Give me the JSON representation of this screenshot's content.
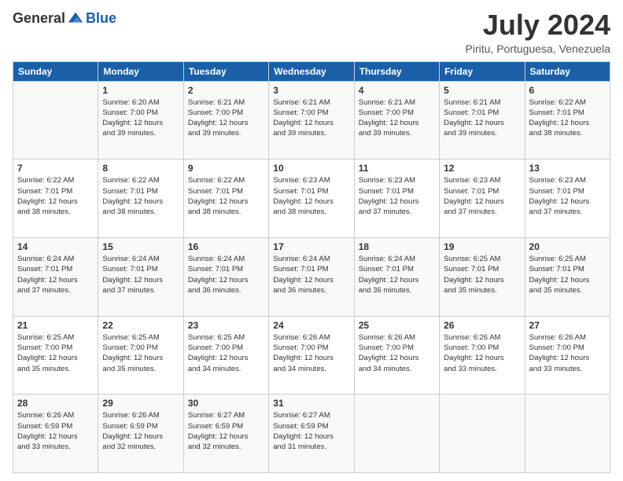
{
  "header": {
    "logo_general": "General",
    "logo_blue": "Blue",
    "month_title": "July 2024",
    "location": "Piritu, Portuguesa, Venezuela"
  },
  "days_of_week": [
    "Sunday",
    "Monday",
    "Tuesday",
    "Wednesday",
    "Thursday",
    "Friday",
    "Saturday"
  ],
  "weeks": [
    [
      {
        "day": "",
        "info": ""
      },
      {
        "day": "1",
        "info": "Sunrise: 6:20 AM\nSunset: 7:00 PM\nDaylight: 12 hours\nand 39 minutes."
      },
      {
        "day": "2",
        "info": "Sunrise: 6:21 AM\nSunset: 7:00 PM\nDaylight: 12 hours\nand 39 minutes."
      },
      {
        "day": "3",
        "info": "Sunrise: 6:21 AM\nSunset: 7:00 PM\nDaylight: 12 hours\nand 39 minutes."
      },
      {
        "day": "4",
        "info": "Sunrise: 6:21 AM\nSunset: 7:00 PM\nDaylight: 12 hours\nand 39 minutes."
      },
      {
        "day": "5",
        "info": "Sunrise: 6:21 AM\nSunset: 7:01 PM\nDaylight: 12 hours\nand 39 minutes."
      },
      {
        "day": "6",
        "info": "Sunrise: 6:22 AM\nSunset: 7:01 PM\nDaylight: 12 hours\nand 38 minutes."
      }
    ],
    [
      {
        "day": "7",
        "info": "Sunrise: 6:22 AM\nSunset: 7:01 PM\nDaylight: 12 hours\nand 38 minutes."
      },
      {
        "day": "8",
        "info": "Sunrise: 6:22 AM\nSunset: 7:01 PM\nDaylight: 12 hours\nand 38 minutes."
      },
      {
        "day": "9",
        "info": "Sunrise: 6:22 AM\nSunset: 7:01 PM\nDaylight: 12 hours\nand 38 minutes."
      },
      {
        "day": "10",
        "info": "Sunrise: 6:23 AM\nSunset: 7:01 PM\nDaylight: 12 hours\nand 38 minutes."
      },
      {
        "day": "11",
        "info": "Sunrise: 6:23 AM\nSunset: 7:01 PM\nDaylight: 12 hours\nand 37 minutes."
      },
      {
        "day": "12",
        "info": "Sunrise: 6:23 AM\nSunset: 7:01 PM\nDaylight: 12 hours\nand 37 minutes."
      },
      {
        "day": "13",
        "info": "Sunrise: 6:23 AM\nSunset: 7:01 PM\nDaylight: 12 hours\nand 37 minutes."
      }
    ],
    [
      {
        "day": "14",
        "info": "Sunrise: 6:24 AM\nSunset: 7:01 PM\nDaylight: 12 hours\nand 37 minutes."
      },
      {
        "day": "15",
        "info": "Sunrise: 6:24 AM\nSunset: 7:01 PM\nDaylight: 12 hours\nand 37 minutes."
      },
      {
        "day": "16",
        "info": "Sunrise: 6:24 AM\nSunset: 7:01 PM\nDaylight: 12 hours\nand 36 minutes."
      },
      {
        "day": "17",
        "info": "Sunrise: 6:24 AM\nSunset: 7:01 PM\nDaylight: 12 hours\nand 36 minutes."
      },
      {
        "day": "18",
        "info": "Sunrise: 6:24 AM\nSunset: 7:01 PM\nDaylight: 12 hours\nand 36 minutes."
      },
      {
        "day": "19",
        "info": "Sunrise: 6:25 AM\nSunset: 7:01 PM\nDaylight: 12 hours\nand 35 minutes."
      },
      {
        "day": "20",
        "info": "Sunrise: 6:25 AM\nSunset: 7:01 PM\nDaylight: 12 hours\nand 35 minutes."
      }
    ],
    [
      {
        "day": "21",
        "info": "Sunrise: 6:25 AM\nSunset: 7:00 PM\nDaylight: 12 hours\nand 35 minutes."
      },
      {
        "day": "22",
        "info": "Sunrise: 6:25 AM\nSunset: 7:00 PM\nDaylight: 12 hours\nand 35 minutes."
      },
      {
        "day": "23",
        "info": "Sunrise: 6:25 AM\nSunset: 7:00 PM\nDaylight: 12 hours\nand 34 minutes."
      },
      {
        "day": "24",
        "info": "Sunrise: 6:26 AM\nSunset: 7:00 PM\nDaylight: 12 hours\nand 34 minutes."
      },
      {
        "day": "25",
        "info": "Sunrise: 6:26 AM\nSunset: 7:00 PM\nDaylight: 12 hours\nand 34 minutes."
      },
      {
        "day": "26",
        "info": "Sunrise: 6:26 AM\nSunset: 7:00 PM\nDaylight: 12 hours\nand 33 minutes."
      },
      {
        "day": "27",
        "info": "Sunrise: 6:26 AM\nSunset: 7:00 PM\nDaylight: 12 hours\nand 33 minutes."
      }
    ],
    [
      {
        "day": "28",
        "info": "Sunrise: 6:26 AM\nSunset: 6:59 PM\nDaylight: 12 hours\nand 33 minutes."
      },
      {
        "day": "29",
        "info": "Sunrise: 6:26 AM\nSunset: 6:59 PM\nDaylight: 12 hours\nand 32 minutes."
      },
      {
        "day": "30",
        "info": "Sunrise: 6:27 AM\nSunset: 6:59 PM\nDaylight: 12 hours\nand 32 minutes."
      },
      {
        "day": "31",
        "info": "Sunrise: 6:27 AM\nSunset: 6:59 PM\nDaylight: 12 hours\nand 31 minutes."
      },
      {
        "day": "",
        "info": ""
      },
      {
        "day": "",
        "info": ""
      },
      {
        "day": "",
        "info": ""
      }
    ]
  ]
}
